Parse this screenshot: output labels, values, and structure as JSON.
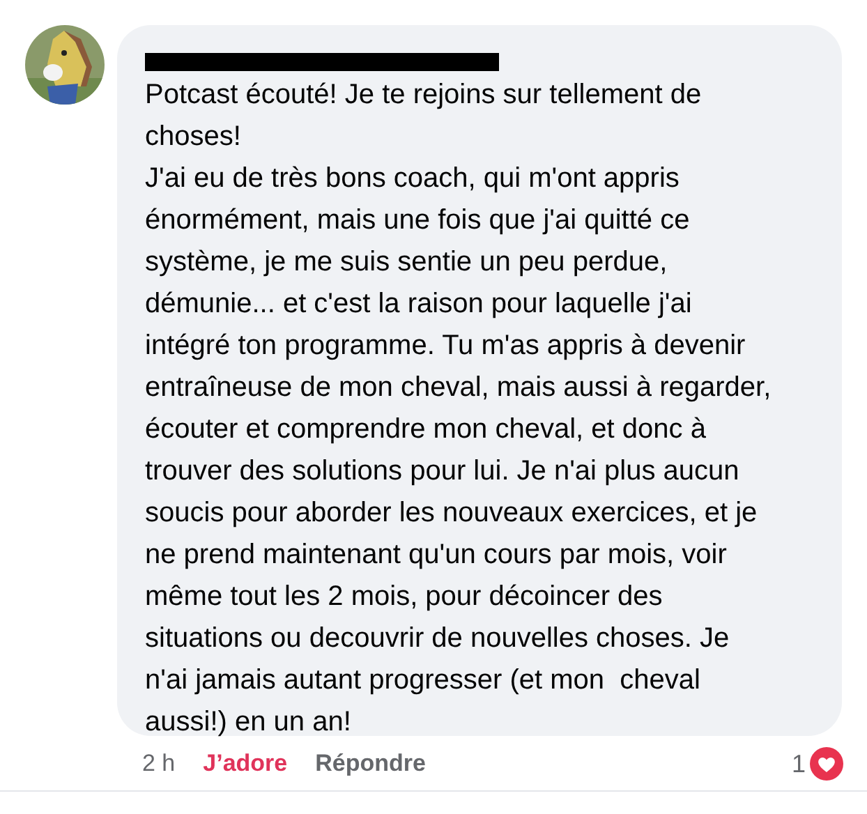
{
  "comment": {
    "author_redacted": true,
    "paragraphs": [
      "Potcast écouté! Je te rejoins sur tellement de choses!",
      "J'ai eu de très bons coach, qui m'ont appris énormément, mais une fois que j'ai quitté ce système, je me suis sentie un peu perdue, démunie... et c'est la raison pour laquelle j'ai intégré ton programme. Tu m'as appris à devenir entraîneuse de mon cheval, mais aussi à regarder, écouter et comprendre mon cheval, et donc à trouver des solutions pour lui. Je n'ai plus aucun soucis pour aborder les nouveaux exercices, et je ne prend maintenant qu'un cours par mois, voir même tout les 2 mois, pour décoincer des situations ou decouvrir de nouvelles choses. Je n'ai jamais autant progresser (et mon  cheval aussi!) en un an!"
    ],
    "time": "2 h",
    "like_label": "J’adore",
    "liked": true,
    "reply_label": "Répondre",
    "reaction_count": "1"
  }
}
